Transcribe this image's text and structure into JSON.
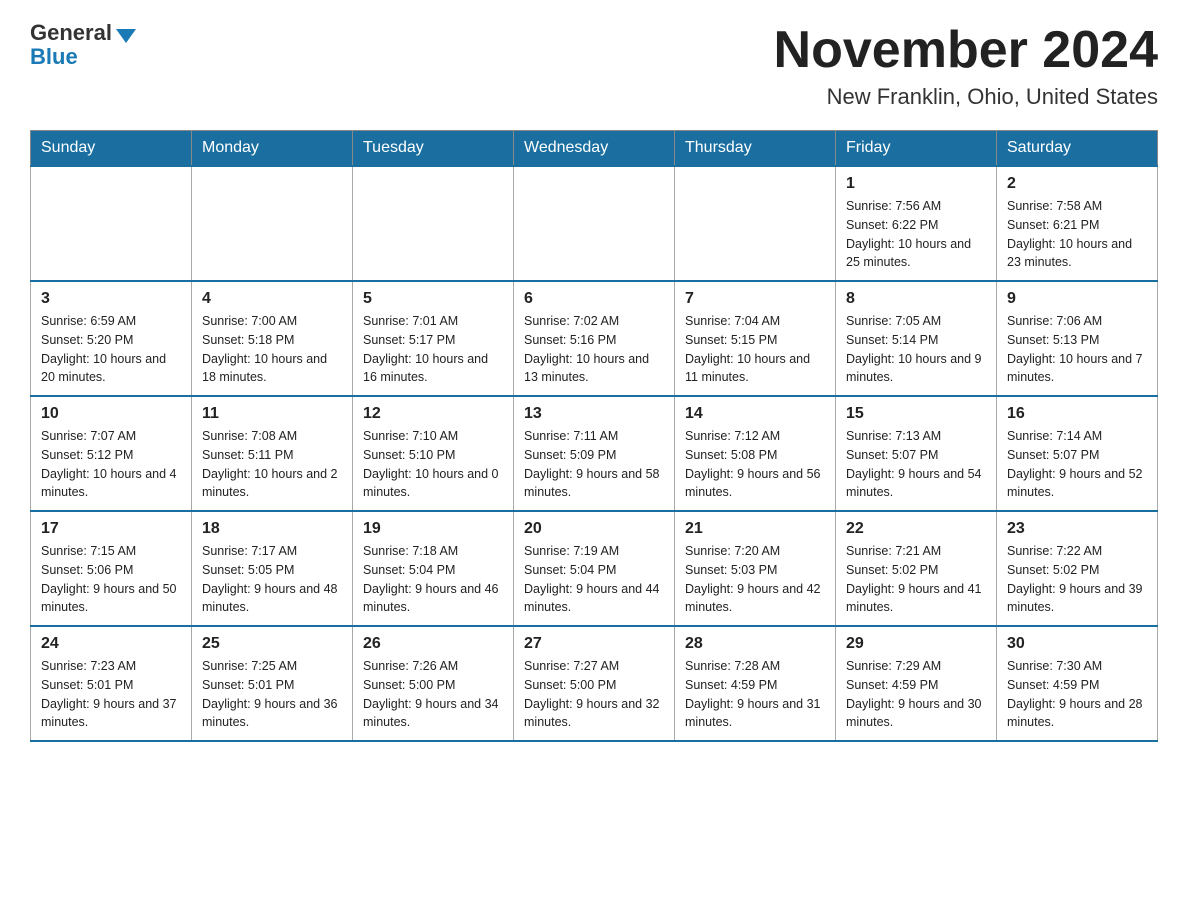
{
  "logo": {
    "general": "General",
    "blue": "Blue"
  },
  "title": "November 2024",
  "location": "New Franklin, Ohio, United States",
  "weekdays": [
    "Sunday",
    "Monday",
    "Tuesday",
    "Wednesday",
    "Thursday",
    "Friday",
    "Saturday"
  ],
  "weeks": [
    [
      {
        "day": "",
        "info": ""
      },
      {
        "day": "",
        "info": ""
      },
      {
        "day": "",
        "info": ""
      },
      {
        "day": "",
        "info": ""
      },
      {
        "day": "",
        "info": ""
      },
      {
        "day": "1",
        "info": "Sunrise: 7:56 AM\nSunset: 6:22 PM\nDaylight: 10 hours and 25 minutes."
      },
      {
        "day": "2",
        "info": "Sunrise: 7:58 AM\nSunset: 6:21 PM\nDaylight: 10 hours and 23 minutes."
      }
    ],
    [
      {
        "day": "3",
        "info": "Sunrise: 6:59 AM\nSunset: 5:20 PM\nDaylight: 10 hours and 20 minutes."
      },
      {
        "day": "4",
        "info": "Sunrise: 7:00 AM\nSunset: 5:18 PM\nDaylight: 10 hours and 18 minutes."
      },
      {
        "day": "5",
        "info": "Sunrise: 7:01 AM\nSunset: 5:17 PM\nDaylight: 10 hours and 16 minutes."
      },
      {
        "day": "6",
        "info": "Sunrise: 7:02 AM\nSunset: 5:16 PM\nDaylight: 10 hours and 13 minutes."
      },
      {
        "day": "7",
        "info": "Sunrise: 7:04 AM\nSunset: 5:15 PM\nDaylight: 10 hours and 11 minutes."
      },
      {
        "day": "8",
        "info": "Sunrise: 7:05 AM\nSunset: 5:14 PM\nDaylight: 10 hours and 9 minutes."
      },
      {
        "day": "9",
        "info": "Sunrise: 7:06 AM\nSunset: 5:13 PM\nDaylight: 10 hours and 7 minutes."
      }
    ],
    [
      {
        "day": "10",
        "info": "Sunrise: 7:07 AM\nSunset: 5:12 PM\nDaylight: 10 hours and 4 minutes."
      },
      {
        "day": "11",
        "info": "Sunrise: 7:08 AM\nSunset: 5:11 PM\nDaylight: 10 hours and 2 minutes."
      },
      {
        "day": "12",
        "info": "Sunrise: 7:10 AM\nSunset: 5:10 PM\nDaylight: 10 hours and 0 minutes."
      },
      {
        "day": "13",
        "info": "Sunrise: 7:11 AM\nSunset: 5:09 PM\nDaylight: 9 hours and 58 minutes."
      },
      {
        "day": "14",
        "info": "Sunrise: 7:12 AM\nSunset: 5:08 PM\nDaylight: 9 hours and 56 minutes."
      },
      {
        "day": "15",
        "info": "Sunrise: 7:13 AM\nSunset: 5:07 PM\nDaylight: 9 hours and 54 minutes."
      },
      {
        "day": "16",
        "info": "Sunrise: 7:14 AM\nSunset: 5:07 PM\nDaylight: 9 hours and 52 minutes."
      }
    ],
    [
      {
        "day": "17",
        "info": "Sunrise: 7:15 AM\nSunset: 5:06 PM\nDaylight: 9 hours and 50 minutes."
      },
      {
        "day": "18",
        "info": "Sunrise: 7:17 AM\nSunset: 5:05 PM\nDaylight: 9 hours and 48 minutes."
      },
      {
        "day": "19",
        "info": "Sunrise: 7:18 AM\nSunset: 5:04 PM\nDaylight: 9 hours and 46 minutes."
      },
      {
        "day": "20",
        "info": "Sunrise: 7:19 AM\nSunset: 5:04 PM\nDaylight: 9 hours and 44 minutes."
      },
      {
        "day": "21",
        "info": "Sunrise: 7:20 AM\nSunset: 5:03 PM\nDaylight: 9 hours and 42 minutes."
      },
      {
        "day": "22",
        "info": "Sunrise: 7:21 AM\nSunset: 5:02 PM\nDaylight: 9 hours and 41 minutes."
      },
      {
        "day": "23",
        "info": "Sunrise: 7:22 AM\nSunset: 5:02 PM\nDaylight: 9 hours and 39 minutes."
      }
    ],
    [
      {
        "day": "24",
        "info": "Sunrise: 7:23 AM\nSunset: 5:01 PM\nDaylight: 9 hours and 37 minutes."
      },
      {
        "day": "25",
        "info": "Sunrise: 7:25 AM\nSunset: 5:01 PM\nDaylight: 9 hours and 36 minutes."
      },
      {
        "day": "26",
        "info": "Sunrise: 7:26 AM\nSunset: 5:00 PM\nDaylight: 9 hours and 34 minutes."
      },
      {
        "day": "27",
        "info": "Sunrise: 7:27 AM\nSunset: 5:00 PM\nDaylight: 9 hours and 32 minutes."
      },
      {
        "day": "28",
        "info": "Sunrise: 7:28 AM\nSunset: 4:59 PM\nDaylight: 9 hours and 31 minutes."
      },
      {
        "day": "29",
        "info": "Sunrise: 7:29 AM\nSunset: 4:59 PM\nDaylight: 9 hours and 30 minutes."
      },
      {
        "day": "30",
        "info": "Sunrise: 7:30 AM\nSunset: 4:59 PM\nDaylight: 9 hours and 28 minutes."
      }
    ]
  ]
}
